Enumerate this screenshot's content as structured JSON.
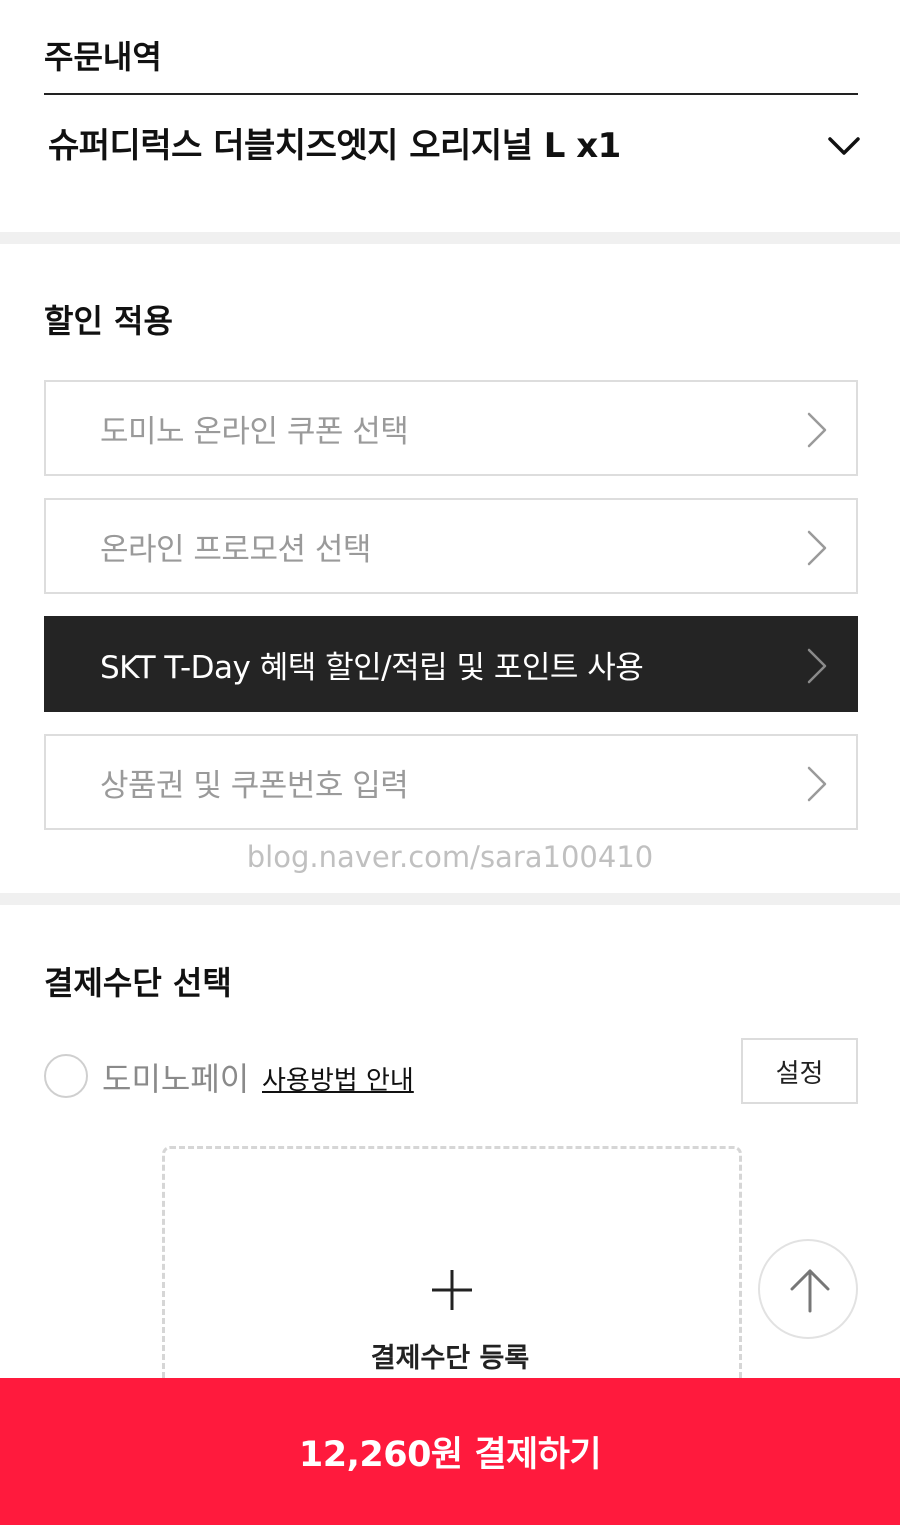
{
  "order": {
    "title": "주문내역",
    "item": "슈퍼디럭스 더블치즈엣지 오리지널 L x1"
  },
  "discount": {
    "title": "할인 적용",
    "options": [
      {
        "label": "도미노 온라인 쿠폰 선택"
      },
      {
        "label": "온라인 프로모션 선택"
      },
      {
        "label": "SKT T-Day 혜택 할인/적립 및 포인트 사용"
      },
      {
        "label": "상품권 및 쿠폰번호 입력"
      }
    ]
  },
  "watermark": "blog.naver.com/sara100410",
  "payment": {
    "title": "결제수단 선택",
    "method_name": "도미노페이",
    "guide_link": "사용방법 안내",
    "settings_label": "설정",
    "register_label": "결제수단 등록"
  },
  "checkout": {
    "label": "12,260원 결제하기"
  },
  "colors": {
    "accent": "#ff1a3d",
    "dark_row": "#242424"
  },
  "icons": [
    "chevron-down-icon",
    "chevron-right-icon",
    "plus-icon",
    "arrow-up-icon"
  ]
}
